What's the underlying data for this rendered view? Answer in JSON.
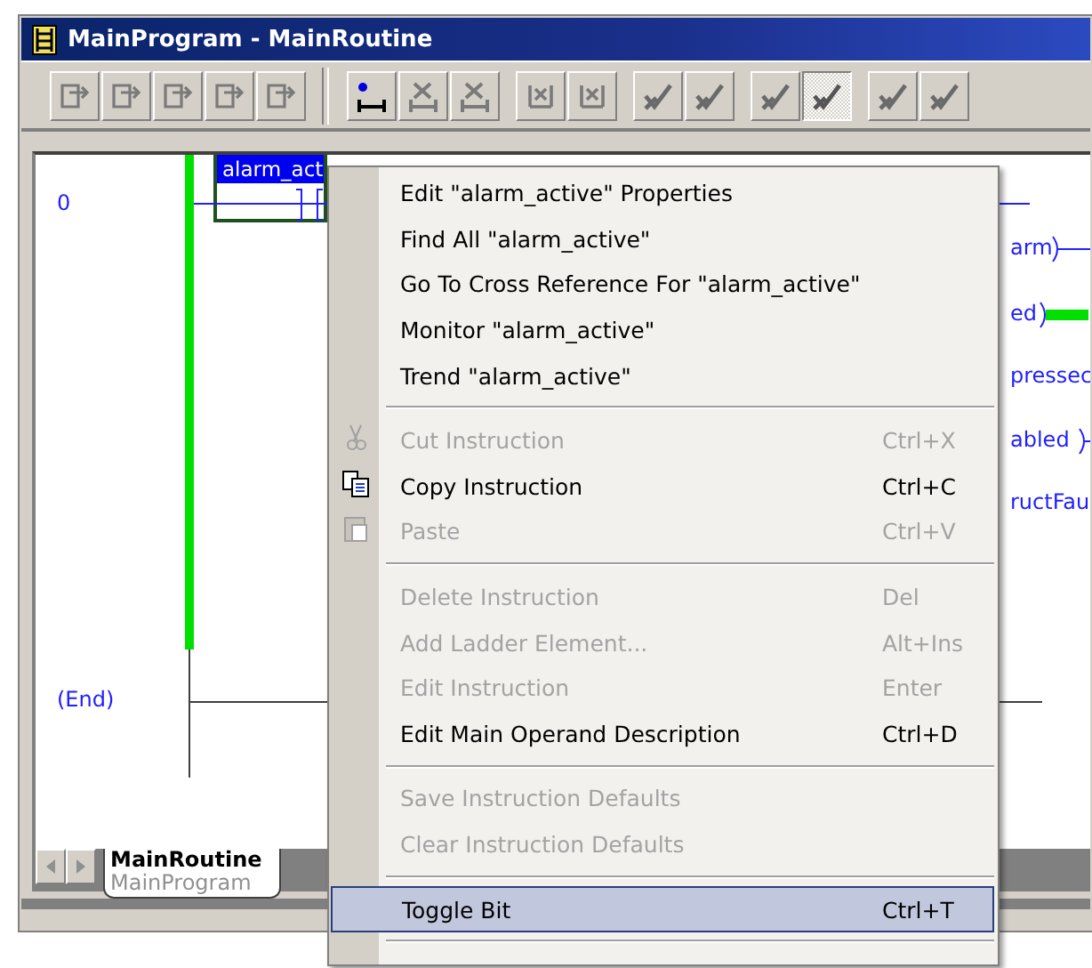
{
  "window": {
    "title": "MainProgram - MainRoutine"
  },
  "toolbar": {
    "groups": [
      [
        {
          "pressed": false
        },
        {
          "pressed": false
        },
        {
          "pressed": false
        },
        {
          "pressed": false
        },
        {
          "pressed": false
        }
      ],
      [
        {
          "pressed": false
        },
        {
          "pressed": false
        },
        {
          "pressed": false
        }
      ],
      [
        {
          "pressed": false
        },
        {
          "pressed": false
        }
      ],
      [
        {
          "pressed": false
        },
        {
          "pressed": false
        }
      ],
      [
        {
          "pressed": false
        },
        {
          "pressed": true
        }
      ],
      [
        {
          "pressed": false
        },
        {
          "pressed": false
        }
      ]
    ]
  },
  "ladder": {
    "rungs": [
      {
        "number": "0",
        "energized": true,
        "instruction": {
          "tag": "alarm_act",
          "selected": true
        }
      }
    ],
    "end_label": "(End)",
    "right_fragments": [
      {
        "text": "arm",
        "energized": false
      },
      {
        "text": "ed",
        "energized": true
      },
      {
        "text": "pressec"
      },
      {
        "text": "abled",
        "energized": false
      },
      {
        "text": "ructFau"
      }
    ]
  },
  "tabs": [
    {
      "title": "MainRoutine",
      "subtitle": "MainProgram",
      "selected": true
    }
  ],
  "context_menu": {
    "groups": [
      [
        {
          "label": "Edit \"alarm_active\" Properties",
          "disabled": false,
          "highlighted": false
        },
        {
          "label": "Find All \"alarm_active\"",
          "disabled": false,
          "highlighted": false
        },
        {
          "label": "Go To Cross Reference For \"alarm_active\"",
          "disabled": false,
          "highlighted": false
        },
        {
          "label": "Monitor \"alarm_active\"",
          "disabled": false,
          "highlighted": false
        },
        {
          "label": "Trend \"alarm_active\"",
          "disabled": false,
          "highlighted": false
        }
      ],
      [
        {
          "label": "Cut Instruction",
          "shortcut": "Ctrl+X",
          "disabled": true,
          "highlighted": false
        },
        {
          "label": "Copy Instruction",
          "shortcut": "Ctrl+C",
          "disabled": false,
          "highlighted": false
        },
        {
          "label": "Paste",
          "shortcut": "Ctrl+V",
          "disabled": true,
          "highlighted": false
        }
      ],
      [
        {
          "label": "Delete Instruction",
          "shortcut": "Del",
          "disabled": true,
          "highlighted": false
        },
        {
          "label": "Add Ladder Element...",
          "shortcut": "Alt+Ins",
          "disabled": true,
          "highlighted": false
        },
        {
          "label": "Edit Instruction",
          "shortcut": "Enter",
          "disabled": true,
          "highlighted": false
        },
        {
          "label": "Edit Main Operand Description",
          "shortcut": "Ctrl+D",
          "disabled": false,
          "highlighted": false
        }
      ],
      [
        {
          "label": "Save Instruction Defaults",
          "disabled": true,
          "highlighted": false
        },
        {
          "label": "Clear Instruction Defaults",
          "disabled": true,
          "highlighted": false
        }
      ],
      [
        {
          "label": "Toggle Bit",
          "shortcut": "Ctrl+T",
          "disabled": false,
          "highlighted": true
        }
      ]
    ]
  }
}
